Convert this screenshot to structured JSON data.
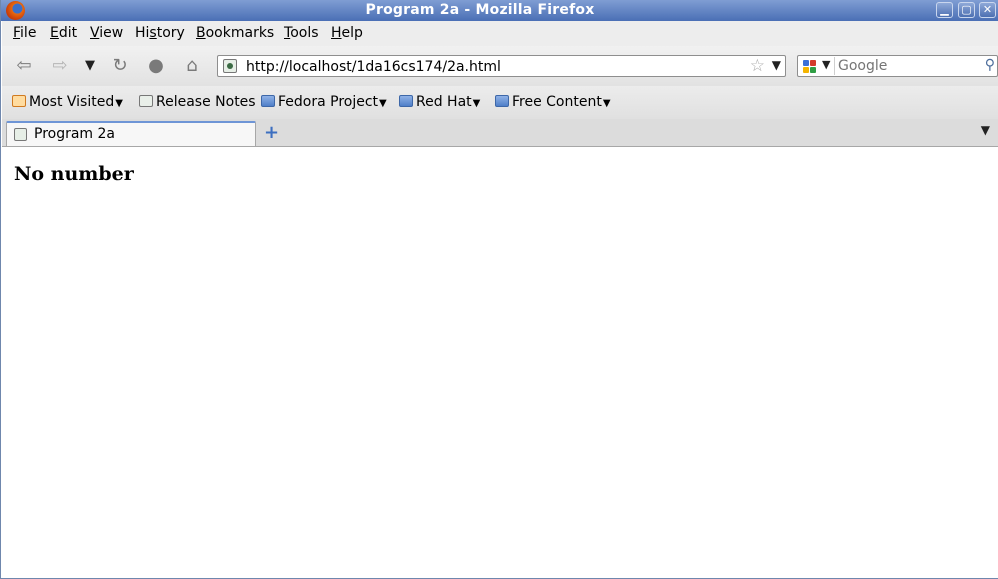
{
  "window": {
    "title": "Program 2a - Mozilla Firefox"
  },
  "menubar": {
    "items": [
      {
        "access": "F",
        "rest": "ile"
      },
      {
        "access": "E",
        "rest": "dit"
      },
      {
        "access": "V",
        "rest": "iew"
      },
      {
        "pre": "Hi",
        "access": "s",
        "rest": "tory"
      },
      {
        "access": "B",
        "rest": "ookmarks"
      },
      {
        "access": "T",
        "rest": "ools"
      },
      {
        "access": "H",
        "rest": "elp"
      }
    ]
  },
  "navbar": {
    "url": "http://localhost/1da16cs174/2a.html",
    "search_placeholder": "Google"
  },
  "bookmarks": {
    "items": [
      {
        "label": "Most Visited"
      },
      {
        "label": "Release Notes"
      },
      {
        "label": "Fedora Project"
      },
      {
        "label": "Red Hat"
      },
      {
        "label": "Free Content"
      }
    ]
  },
  "tabs": [
    {
      "label": "Program 2a"
    }
  ],
  "content": {
    "heading": "No number"
  },
  "colors": {
    "titlebar": "#4a6fb5",
    "active_tab_accent": "#6e95d6"
  }
}
